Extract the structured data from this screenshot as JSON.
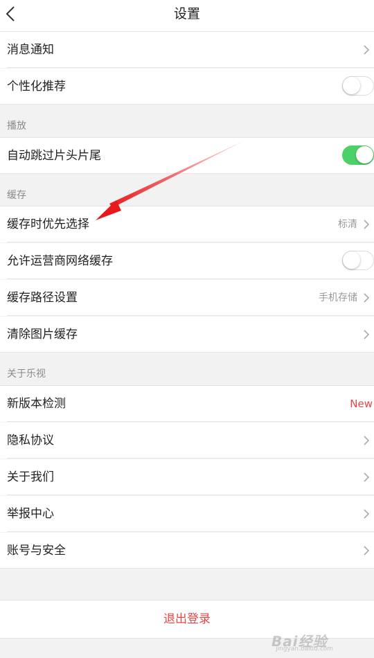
{
  "header": {
    "title": "设置"
  },
  "rows": {
    "notifications": {
      "label": "消息通知"
    },
    "personalized": {
      "label": "个性化推荐",
      "toggle": "off"
    },
    "auto_skip": {
      "label": "自动跳过片头片尾",
      "toggle": "on"
    },
    "cache_priority": {
      "label": "缓存时优先选择",
      "value": "标清"
    },
    "carrier_cache": {
      "label": "允许运营商网络缓存",
      "toggle": "off"
    },
    "cache_path": {
      "label": "缓存路径设置",
      "value": "手机存储"
    },
    "clear_image_cache": {
      "label": "清除图片缓存"
    },
    "version_check": {
      "label": "新版本检测",
      "badge": "New"
    },
    "privacy": {
      "label": "隐私协议"
    },
    "about_us": {
      "label": "关于我们"
    },
    "report_center": {
      "label": "举报中心"
    },
    "account_security": {
      "label": "账号与安全"
    }
  },
  "sections": {
    "playback": "播放",
    "cache": "缓存",
    "about": "关于乐视"
  },
  "logout": {
    "label": "退出登录"
  },
  "watermark": {
    "text": "Bai经验",
    "sub": "jingyan.baidu.com"
  },
  "colors": {
    "accent_red": "#e94545",
    "toggle_on": "#4cd168",
    "annotation_arrow": "#e8191c"
  },
  "icons": {
    "back": "chevron-left-icon",
    "row_link": "chevron-right-icon"
  }
}
